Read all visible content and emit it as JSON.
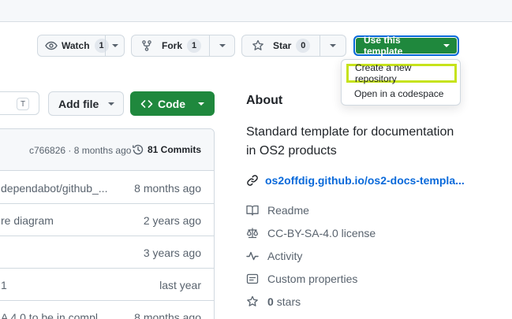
{
  "header": {
    "watch": {
      "label": "Watch",
      "count": "1"
    },
    "fork": {
      "label": "Fork",
      "count": "1"
    },
    "star": {
      "label": "Star",
      "count": "0"
    },
    "use_template": {
      "label": "Use this template"
    }
  },
  "template_menu": {
    "items": [
      {
        "label": "Create a new repository"
      },
      {
        "label": "Open in a codespace"
      }
    ]
  },
  "toolbar": {
    "search_shortcut": "T",
    "add_file": "Add file",
    "code": "Code"
  },
  "files": {
    "latest_commit": "c766826 · 8 months ago",
    "commits_label": "81 Commits",
    "rows": [
      {
        "message": "dependabot/github_...",
        "time": "8 months ago"
      },
      {
        "message": "re diagram",
        "time": "2 years ago"
      },
      {
        "message": "",
        "time": "3 years ago"
      },
      {
        "message": "1",
        "time": "last year"
      },
      {
        "message": "A 4.0 to be in compl...",
        "time": "8 months ago"
      }
    ]
  },
  "about": {
    "title": "About",
    "description": "Standard template for documentation in OS2 products",
    "link": "os2offdig.github.io/os2-docs-templa...",
    "items": [
      {
        "label": "Readme",
        "icon": "book-icon"
      },
      {
        "label": "CC-BY-SA-4.0 license",
        "icon": "law-icon"
      },
      {
        "label": "Activity",
        "icon": "pulse-icon"
      },
      {
        "label": "Custom properties",
        "icon": "note-icon"
      }
    ],
    "stars": {
      "count": "0",
      "label": "stars"
    }
  },
  "colors": {
    "primary_green": "#1f883d",
    "link_blue": "#0969da",
    "highlight": "#c6e31b"
  }
}
